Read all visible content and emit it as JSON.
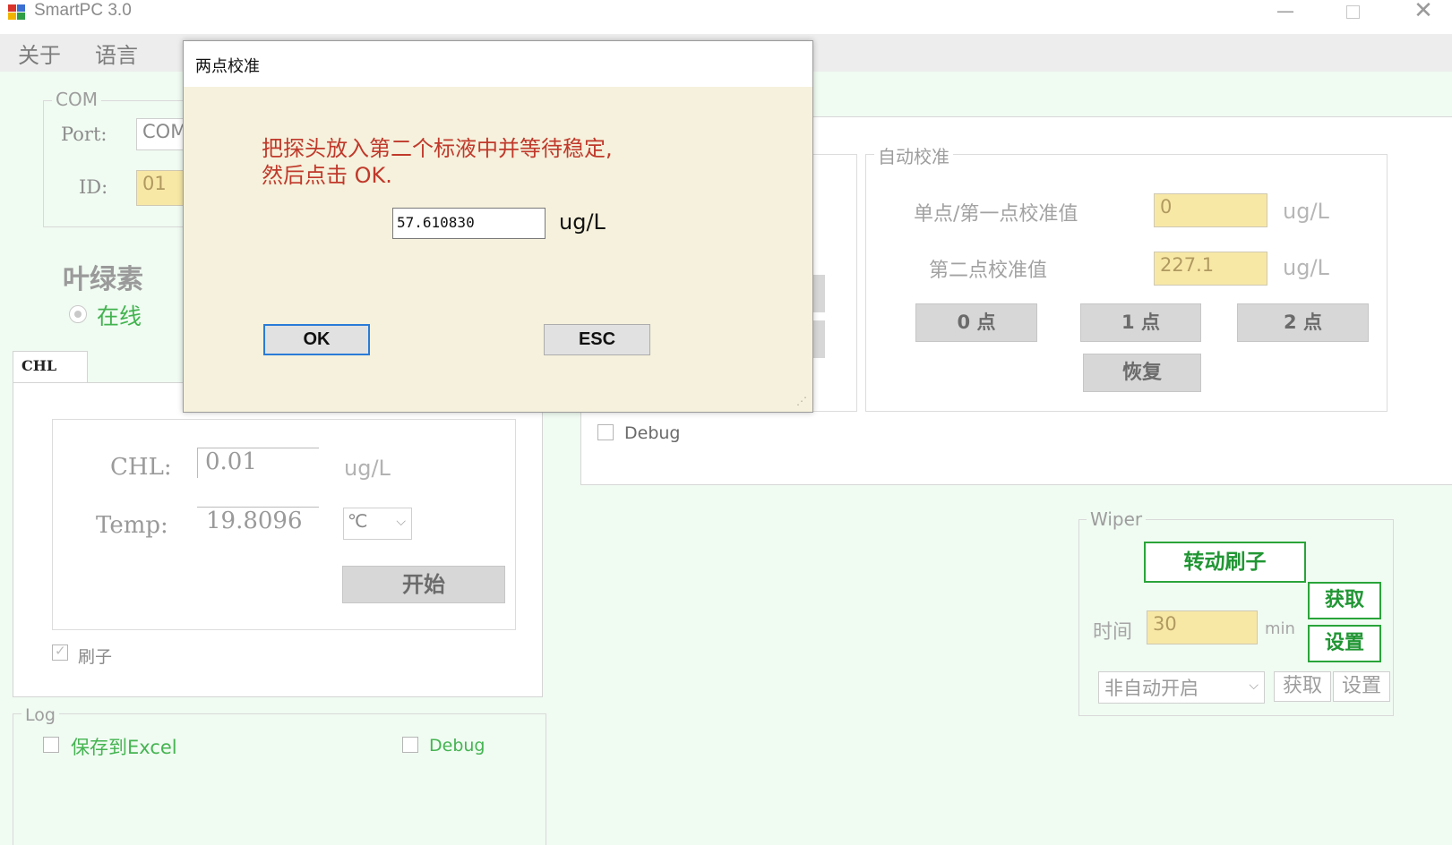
{
  "window": {
    "title": "SmartPC 3.0",
    "min": "—",
    "close": "✕"
  },
  "menu": {
    "about": "关于",
    "language": "语言"
  },
  "com": {
    "legend": "COM",
    "port_label": "Port:",
    "port_value": "COM",
    "id_label": "ID:",
    "id_value": "01"
  },
  "sensor": {
    "title": "叶绿素",
    "online_label": "在线"
  },
  "tab": {
    "label": "CHL"
  },
  "measure": {
    "chl_label": "CHL:",
    "chl_value": "0.01",
    "chl_unit": "ug/L",
    "temp_label": "Temp:",
    "temp_value": "19.8096",
    "temp_unit": "℃",
    "start_button": "开始",
    "brush_label": "刷子"
  },
  "log": {
    "legend": "Log",
    "save_excel": "保存到Excel",
    "debug": "Debug"
  },
  "calib": {
    "legend": "自动校准",
    "point1_label": "单点/第一点校准值",
    "point1_value": "0",
    "point2_label": "第二点校准值",
    "point2_value": "227.1",
    "unit": "ug/L",
    "btn_0": "0 点",
    "btn_1": "1 点",
    "btn_2": "2 点",
    "btn_restore": "恢复",
    "debug": "Debug"
  },
  "wiper": {
    "legend": "Wiper",
    "rotate_button": "转动刷子",
    "get_button": "获取",
    "set_button": "设置",
    "time_label": "时间",
    "time_value": "30",
    "time_unit": "min",
    "mode_value": "非自动开启",
    "get_small": "获取",
    "set_small": "设置"
  },
  "dialog": {
    "title": "两点校准",
    "message": "把探头放入第二个标液中并等待稳定,\n然后点击 OK.",
    "value": "57.610830",
    "unit": "ug/L",
    "ok": "OK",
    "esc": "ESC"
  }
}
